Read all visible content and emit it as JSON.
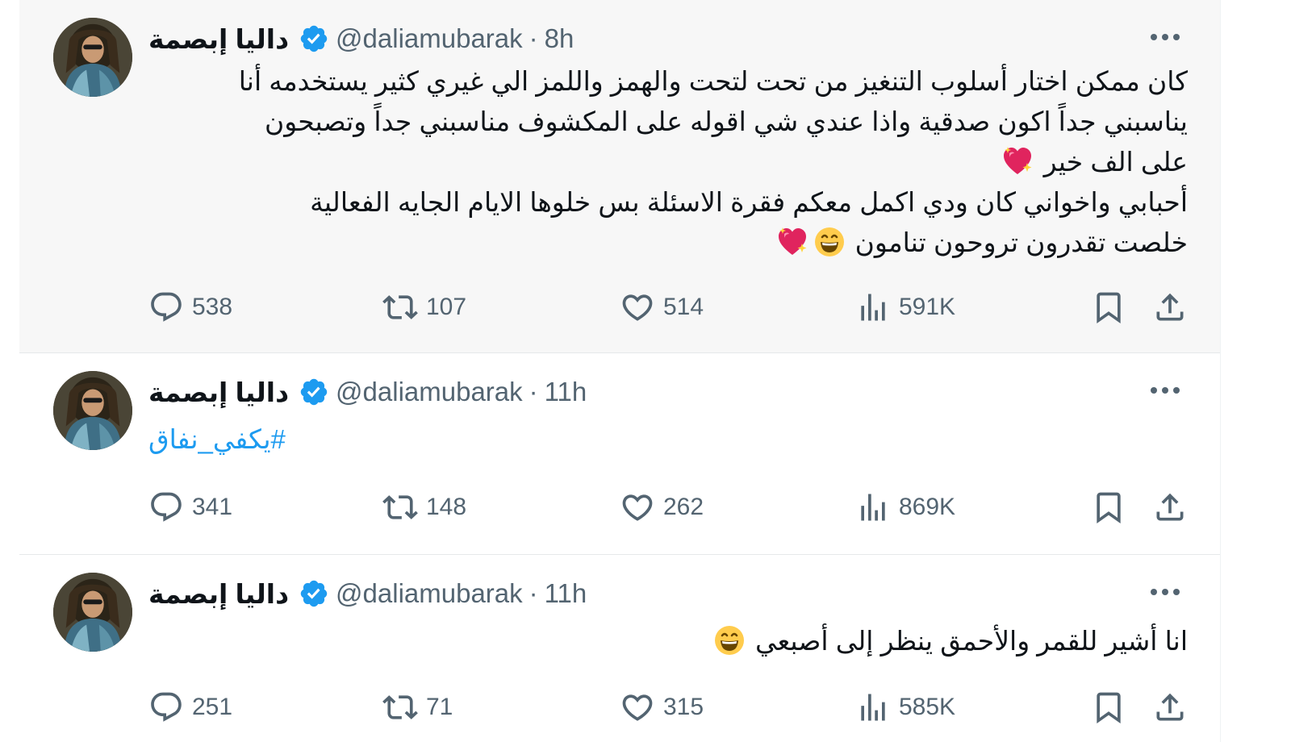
{
  "tweets": [
    {
      "name": "داليا إبصمة",
      "handle": "@daliamubarak",
      "separator": "·",
      "time": "8h",
      "lines": [
        "كان ممكن اختار أسلوب التنغيز من تحت لتحت والهمز واللمز الي غيري كثير يستخدمه أنا",
        "يناسبني جداً اكون صدقية واذا عندي شي اقوله على المكشوف مناسبني جداً وتصبحون",
        "على الف خير",
        "أحبابي واخواني كان ودي اكمل معكم فقرة الاسئلة بس خلوها الايام الجايه الفعالية",
        "خلصت تقدرون تروحون تنامون"
      ],
      "replies": "538",
      "retweets": "107",
      "likes": "514",
      "views": "591K"
    },
    {
      "name": "داليا إبصمة",
      "handle": "@daliamubarak",
      "separator": "·",
      "time": "11h",
      "hashtag": "#يكفي_نفاق",
      "replies": "341",
      "retweets": "148",
      "likes": "262",
      "views": "869K"
    },
    {
      "name": "داليا إبصمة",
      "handle": "@daliamubarak",
      "separator": "·",
      "time": "11h",
      "lines": [
        "انا أشير للقمر والأحمق ينظر إلى أصبعي"
      ],
      "replies": "251",
      "retweets": "71",
      "likes": "315",
      "views": "585K"
    }
  ],
  "icons": {
    "more": "more-icon",
    "verified": "verified-badge-icon",
    "reply": "reply-icon",
    "retweet": "retweet-icon",
    "like": "heart-icon",
    "views": "views-icon",
    "bookmark": "bookmark-icon",
    "share": "share-icon",
    "sparkling_heart": "sparkling-heart-emoji",
    "grin": "grinning-face-emoji"
  },
  "colors": {
    "verified": "#1d9bf0",
    "hashtag": "#1d9bf0",
    "secondary_text": "#536471",
    "highlight_bg": "#f7f7f7"
  }
}
